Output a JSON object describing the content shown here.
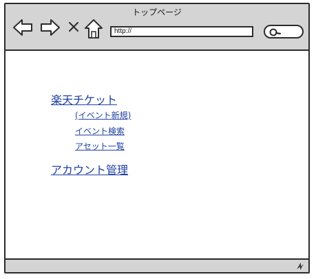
{
  "window": {
    "title": "トップページ"
  },
  "toolbar": {
    "url_value": "http://",
    "icons": [
      "back-arrow-icon",
      "forward-arrow-icon",
      "close-x-icon",
      "home-icon",
      "search-icon"
    ]
  },
  "content": {
    "links": [
      {
        "label": "楽天チケット",
        "level": 0
      },
      {
        "label": "(イベント新規)",
        "level": 1
      },
      {
        "label": "イベント検索",
        "level": 1
      },
      {
        "label": "アセット一覧",
        "level": 1
      },
      {
        "label": "アカウント管理",
        "level": 0
      }
    ]
  },
  "colors": {
    "chrome": "#d4d4d4",
    "border": "#2b2b2b",
    "link": "#1f3fa0"
  }
}
